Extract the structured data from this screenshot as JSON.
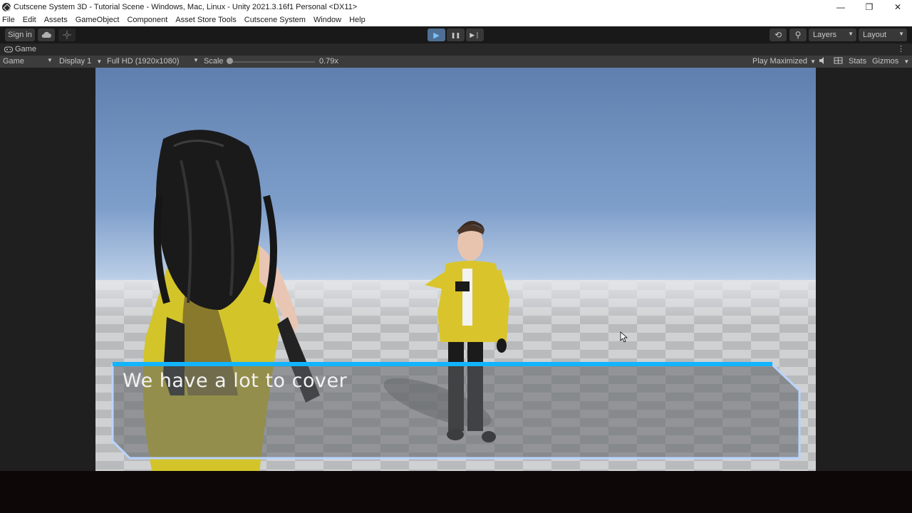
{
  "window": {
    "title": "Cutscene System 3D - Tutorial Scene - Windows, Mac, Linux - Unity 2021.3.16f1 Personal <DX11>",
    "minimize_glyph": "—",
    "maximize_glyph": "❐",
    "close_glyph": "✕"
  },
  "menu": [
    "File",
    "Edit",
    "Assets",
    "GameObject",
    "Component",
    "Asset Store Tools",
    "Cutscene System",
    "Window",
    "Help"
  ],
  "toolbar": {
    "sign_in": "Sign in",
    "cloud_icon": "cloud-icon",
    "collab_icon": "collab-icon",
    "play_glyph": "▶",
    "pause_glyph": "❚❚",
    "step_glyph": "▶❘",
    "history_glyph": "⟲",
    "search_glyph": "⚲",
    "layers_label": "Layers",
    "layout_label": "Layout"
  },
  "tab": {
    "label": "Game",
    "more_glyph": "⋮"
  },
  "game_bar": {
    "mode": "Game",
    "display": "Display 1",
    "resolution": "Full HD (1920x1080)",
    "scale_label": "Scale",
    "scale_value": "0.79x",
    "play_maximized": "Play Maximized",
    "stats": "Stats",
    "gizmos": "Gizmos"
  },
  "dialogue": {
    "text": "We have a lot to cover"
  },
  "colors": {
    "accent_play": "#4f6f94",
    "dialog_border": "#12b4ff",
    "dialog_frame": "#b8d4ff"
  }
}
